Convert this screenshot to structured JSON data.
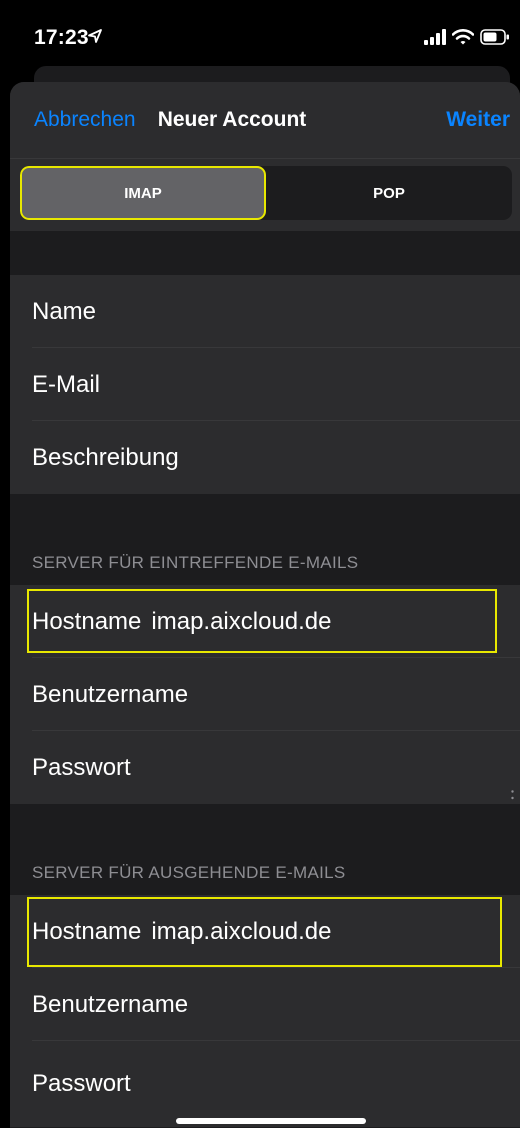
{
  "status_bar": {
    "time": "17:23"
  },
  "nav": {
    "cancel": "Abbrechen",
    "title": "Neuer Account",
    "next": "Weiter"
  },
  "segmented": {
    "options": [
      "IMAP",
      "POP"
    ],
    "selected": "IMAP"
  },
  "account": {
    "name_label": "Name",
    "email_label": "E-Mail",
    "description_label": "Beschreibung"
  },
  "incoming": {
    "header": "SERVER FÜR EINTREFFENDE E-MAILS",
    "hostname_label": "Hostname",
    "hostname_value": "imap.aixcloud.de",
    "username_label": "Benutzername",
    "password_label": "Passwort"
  },
  "outgoing": {
    "header": "SERVER FÜR AUSGEHENDE E-MAILS",
    "hostname_label": "Hostname",
    "hostname_value": "imap.aixcloud.de",
    "username_label": "Benutzername",
    "password_label": "Passwort"
  },
  "colors": {
    "accent": "#0a84ff",
    "highlight": "#e8e800",
    "background": "#1c1c1e",
    "cell": "#2c2c2e"
  }
}
